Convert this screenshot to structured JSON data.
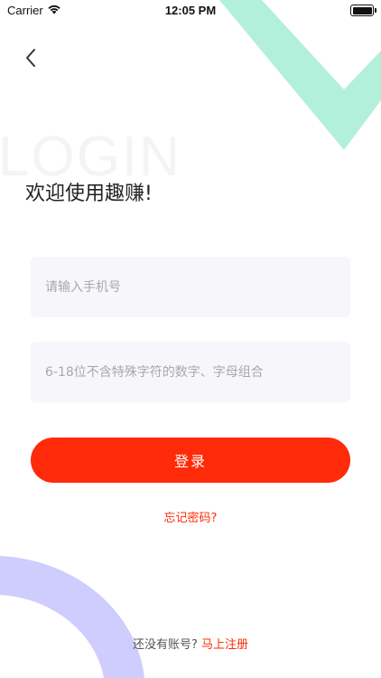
{
  "status_bar": {
    "carrier": "Carrier",
    "time": "12:05 PM"
  },
  "watermark": "LOGIN",
  "welcome_text": "欢迎使用趣赚!",
  "phone_field": {
    "placeholder": "请输入手机号",
    "value": ""
  },
  "password_field": {
    "placeholder": "6-18位不含特殊字符的数字、字母组合",
    "value": ""
  },
  "login_button": "登录",
  "forgot_password": "忘记密码?",
  "register": {
    "prompt": "还没有账号?",
    "link": "马上注册"
  },
  "colors": {
    "accent": "#ff2a09",
    "input_bg": "#f7f6fb",
    "deco_green": "#b3f0dc",
    "deco_purple": "#cecdfd"
  }
}
